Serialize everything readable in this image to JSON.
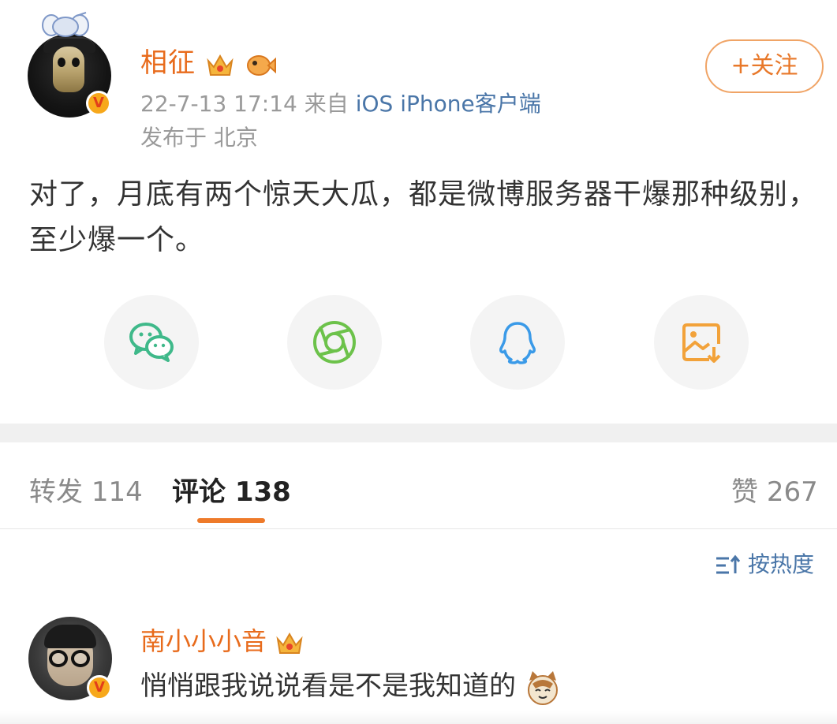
{
  "post": {
    "username": "相征",
    "time": "22-7-13 17:14",
    "source_prefix": "来自",
    "source": "iOS iPhone客户端",
    "location": "发布于 北京",
    "follow_label": "+关注",
    "text": "对了，月底有两个惊天大瓜，都是微博服务器干爆那种级别，至少爆一个。",
    "verified_mark": "V"
  },
  "share": {
    "items": [
      {
        "icon": "wechat-icon"
      },
      {
        "icon": "moments-icon"
      },
      {
        "icon": "qq-icon"
      },
      {
        "icon": "save-image-icon"
      }
    ]
  },
  "tabs": {
    "repost_label": "转发",
    "repost_count": "114",
    "comment_label": "评论",
    "comment_count": "138",
    "like_label": "赞",
    "like_count": "267"
  },
  "sort": {
    "label": "按热度"
  },
  "comment": {
    "username": "南小小小音",
    "text": "悄悄跟我说说看是不是我知道的",
    "verified_mark": "V"
  },
  "colors": {
    "accent_orange": "#e86b1c",
    "link_blue": "#4a76a8",
    "meta_gray": "#9a9a9a"
  }
}
